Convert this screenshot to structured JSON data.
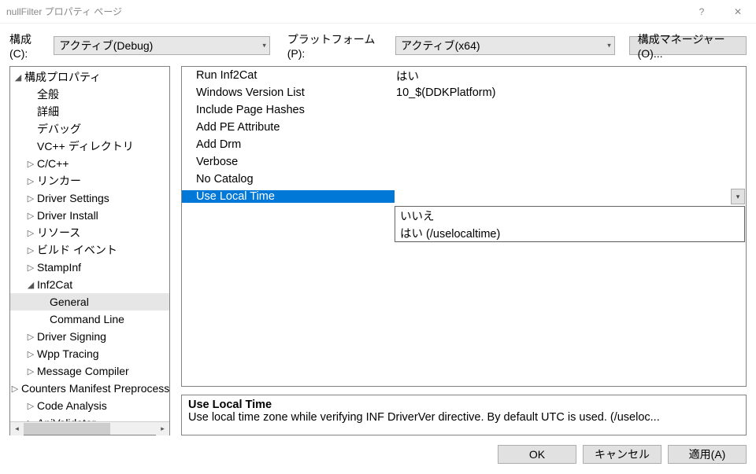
{
  "window": {
    "title": "nullFilter プロパティ ページ",
    "help": "?",
    "close": "✕"
  },
  "toolbar": {
    "config_label": "構成(C):",
    "config_value": "アクティブ(Debug)",
    "platform_label": "プラットフォーム(P):",
    "platform_value": "アクティブ(x64)",
    "manager_button": "構成マネージャー(O)..."
  },
  "tree": {
    "root": "構成プロパティ",
    "items": [
      {
        "indent": 1,
        "twist": "◢",
        "label": "構成プロパティ"
      },
      {
        "indent": 2,
        "twist": "",
        "label": "全般"
      },
      {
        "indent": 2,
        "twist": "",
        "label": "詳細"
      },
      {
        "indent": 2,
        "twist": "",
        "label": "デバッグ"
      },
      {
        "indent": 2,
        "twist": "",
        "label": "VC++ ディレクトリ"
      },
      {
        "indent": 2,
        "twist": "▷",
        "label": "C/C++"
      },
      {
        "indent": 2,
        "twist": "▷",
        "label": "リンカー"
      },
      {
        "indent": 2,
        "twist": "▷",
        "label": "Driver Settings"
      },
      {
        "indent": 2,
        "twist": "▷",
        "label": "Driver Install"
      },
      {
        "indent": 2,
        "twist": "▷",
        "label": "リソース"
      },
      {
        "indent": 2,
        "twist": "▷",
        "label": "ビルド イベント"
      },
      {
        "indent": 2,
        "twist": "▷",
        "label": "StampInf"
      },
      {
        "indent": 2,
        "twist": "◢",
        "label": "Inf2Cat"
      },
      {
        "indent": 3,
        "twist": "",
        "label": "General",
        "selected": true
      },
      {
        "indent": 3,
        "twist": "",
        "label": "Command Line"
      },
      {
        "indent": 2,
        "twist": "▷",
        "label": "Driver Signing"
      },
      {
        "indent": 2,
        "twist": "▷",
        "label": "Wpp Tracing"
      },
      {
        "indent": 2,
        "twist": "▷",
        "label": "Message Compiler"
      },
      {
        "indent": 2,
        "twist": "▷",
        "label": "Counters Manifest Preprocessor"
      },
      {
        "indent": 2,
        "twist": "▷",
        "label": "Code Analysis"
      },
      {
        "indent": 2,
        "twist": "▷",
        "label": "ApiValidator"
      }
    ]
  },
  "grid": {
    "rows": [
      {
        "name": "Run Inf2Cat",
        "value": "はい"
      },
      {
        "name": "Windows Version List",
        "value": "10_$(DDKPlatform)"
      },
      {
        "name": "Include Page Hashes",
        "value": ""
      },
      {
        "name": "Add PE Attribute",
        "value": ""
      },
      {
        "name": "Add Drm",
        "value": ""
      },
      {
        "name": "Verbose",
        "value": ""
      },
      {
        "name": "No Catalog",
        "value": ""
      },
      {
        "name": "Use Local Time",
        "value": "",
        "selected": true
      }
    ],
    "dropdown": {
      "options": [
        "いいえ",
        "はい (/uselocaltime)"
      ]
    }
  },
  "description": {
    "title": "Use Local Time",
    "text": "Use local time zone while verifying INF DriverVer directive. By default UTC is used.  (/useloc..."
  },
  "buttons": {
    "ok": "OK",
    "cancel": "キャンセル",
    "apply": "適用(A)"
  }
}
